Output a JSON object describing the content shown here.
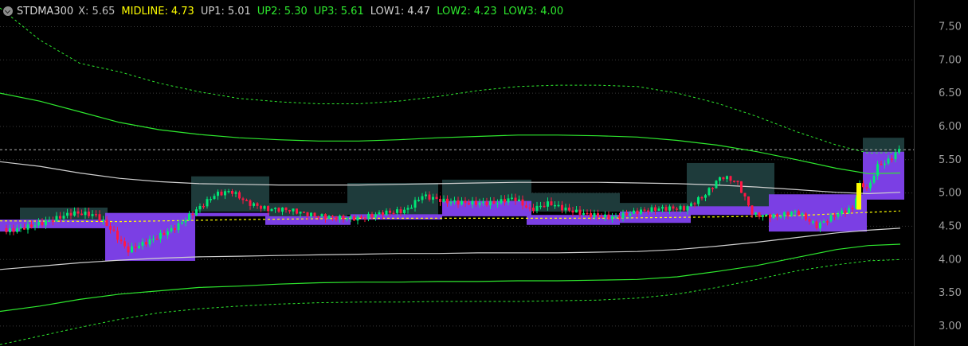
{
  "legend": {
    "name": "STDMA300",
    "items": [
      {
        "label": "X:",
        "value": "5.65",
        "color": "#bdbdbd"
      },
      {
        "label": "MIDLINE:",
        "value": "4.73",
        "color": "#ffff00"
      },
      {
        "label": "UP1:",
        "value": "5.01",
        "color": "#d0d0d0"
      },
      {
        "label": "UP2:",
        "value": "5.30",
        "color": "#2ee82e"
      },
      {
        "label": "UP3:",
        "value": "5.61",
        "color": "#2ee82e"
      },
      {
        "label": "LOW1:",
        "value": "4.47",
        "color": "#d0d0d0"
      },
      {
        "label": "LOW2:",
        "value": "4.23",
        "color": "#2ee82e"
      },
      {
        "label": "LOW3:",
        "value": "4.00",
        "color": "#2ee82e"
      }
    ]
  },
  "colors": {
    "background": "#000000",
    "up_candle": "#00e676",
    "down_candle": "#ff1744",
    "band_green": "#2ee82e",
    "band_white": "#d0d0d0",
    "midline": "#ffff00",
    "purple_box": "#7b3fe4",
    "teal_box": "#1e3b3b",
    "axis_text": "#9e9e9e"
  },
  "chart_data": {
    "type": "line",
    "ylim": [
      2.7,
      7.9
    ],
    "y_ticks": [
      "7.50",
      "7.00",
      "6.50",
      "6.00",
      "5.50",
      "5.00",
      "4.50",
      "4.00",
      "3.50",
      "3.00"
    ],
    "price_reference_line": 5.65,
    "series": [
      {
        "name": "UP3",
        "style": "green-dashed",
        "points": [
          [
            0,
            7.78
          ],
          [
            50,
            7.3
          ],
          [
            100,
            6.95
          ],
          [
            150,
            6.82
          ],
          [
            200,
            6.65
          ],
          [
            250,
            6.52
          ],
          [
            300,
            6.42
          ],
          [
            350,
            6.37
          ],
          [
            400,
            6.34
          ],
          [
            450,
            6.34
          ],
          [
            500,
            6.38
          ],
          [
            550,
            6.45
          ],
          [
            600,
            6.54
          ],
          [
            650,
            6.6
          ],
          [
            700,
            6.62
          ],
          [
            750,
            6.62
          ],
          [
            800,
            6.6
          ],
          [
            850,
            6.5
          ],
          [
            900,
            6.35
          ],
          [
            950,
            6.15
          ],
          [
            1000,
            5.92
          ],
          [
            1050,
            5.72
          ],
          [
            1090,
            5.6
          ],
          [
            1130,
            5.61
          ]
        ]
      },
      {
        "name": "UP2",
        "style": "green-solid",
        "points": [
          [
            0,
            6.5
          ],
          [
            50,
            6.38
          ],
          [
            100,
            6.22
          ],
          [
            150,
            6.06
          ],
          [
            200,
            5.95
          ],
          [
            250,
            5.88
          ],
          [
            300,
            5.83
          ],
          [
            350,
            5.8
          ],
          [
            400,
            5.78
          ],
          [
            450,
            5.78
          ],
          [
            500,
            5.8
          ],
          [
            550,
            5.83
          ],
          [
            600,
            5.85
          ],
          [
            650,
            5.87
          ],
          [
            700,
            5.87
          ],
          [
            750,
            5.86
          ],
          [
            800,
            5.84
          ],
          [
            850,
            5.79
          ],
          [
            900,
            5.72
          ],
          [
            950,
            5.62
          ],
          [
            1000,
            5.5
          ],
          [
            1050,
            5.37
          ],
          [
            1090,
            5.29
          ],
          [
            1130,
            5.3
          ]
        ]
      },
      {
        "name": "UP1",
        "style": "white-solid",
        "points": [
          [
            0,
            5.47
          ],
          [
            50,
            5.4
          ],
          [
            100,
            5.3
          ],
          [
            150,
            5.22
          ],
          [
            200,
            5.17
          ],
          [
            250,
            5.14
          ],
          [
            300,
            5.13
          ],
          [
            350,
            5.12
          ],
          [
            400,
            5.12
          ],
          [
            450,
            5.12
          ],
          [
            500,
            5.13
          ],
          [
            550,
            5.14
          ],
          [
            600,
            5.15
          ],
          [
            650,
            5.16
          ],
          [
            700,
            5.16
          ],
          [
            750,
            5.16
          ],
          [
            800,
            5.15
          ],
          [
            850,
            5.14
          ],
          [
            900,
            5.12
          ],
          [
            950,
            5.09
          ],
          [
            1000,
            5.05
          ],
          [
            1050,
            5.01
          ],
          [
            1090,
            4.99
          ],
          [
            1130,
            5.01
          ]
        ]
      },
      {
        "name": "MIDLINE",
        "style": "yellow-dashed",
        "points": [
          [
            0,
            4.58
          ],
          [
            150,
            4.57
          ],
          [
            300,
            4.6
          ],
          [
            450,
            4.62
          ],
          [
            600,
            4.62
          ],
          [
            750,
            4.62
          ],
          [
            900,
            4.64
          ],
          [
            1000,
            4.66
          ],
          [
            1130,
            4.73
          ]
        ]
      },
      {
        "name": "LOW1",
        "style": "white-solid",
        "points": [
          [
            0,
            3.85
          ],
          [
            50,
            3.9
          ],
          [
            100,
            3.95
          ],
          [
            150,
            3.99
          ],
          [
            200,
            4.02
          ],
          [
            250,
            4.04
          ],
          [
            300,
            4.05
          ],
          [
            350,
            4.06
          ],
          [
            400,
            4.07
          ],
          [
            450,
            4.08
          ],
          [
            500,
            4.09
          ],
          [
            550,
            4.09
          ],
          [
            600,
            4.1
          ],
          [
            650,
            4.1
          ],
          [
            700,
            4.1
          ],
          [
            750,
            4.11
          ],
          [
            800,
            4.12
          ],
          [
            850,
            4.15
          ],
          [
            900,
            4.2
          ],
          [
            950,
            4.26
          ],
          [
            1000,
            4.33
          ],
          [
            1050,
            4.4
          ],
          [
            1090,
            4.44
          ],
          [
            1130,
            4.47
          ]
        ]
      },
      {
        "name": "LOW2",
        "style": "green-solid",
        "points": [
          [
            0,
            3.22
          ],
          [
            50,
            3.3
          ],
          [
            100,
            3.4
          ],
          [
            150,
            3.48
          ],
          [
            200,
            3.53
          ],
          [
            250,
            3.58
          ],
          [
            300,
            3.6
          ],
          [
            350,
            3.63
          ],
          [
            400,
            3.65
          ],
          [
            450,
            3.66
          ],
          [
            500,
            3.66
          ],
          [
            550,
            3.67
          ],
          [
            600,
            3.67
          ],
          [
            650,
            3.68
          ],
          [
            700,
            3.68
          ],
          [
            750,
            3.69
          ],
          [
            800,
            3.7
          ],
          [
            850,
            3.74
          ],
          [
            900,
            3.82
          ],
          [
            950,
            3.91
          ],
          [
            1000,
            4.03
          ],
          [
            1050,
            4.15
          ],
          [
            1090,
            4.21
          ],
          [
            1130,
            4.23
          ]
        ]
      },
      {
        "name": "LOW3",
        "style": "green-dashed",
        "points": [
          [
            0,
            2.72
          ],
          [
            50,
            2.85
          ],
          [
            100,
            2.98
          ],
          [
            150,
            3.1
          ],
          [
            200,
            3.2
          ],
          [
            250,
            3.26
          ],
          [
            300,
            3.3
          ],
          [
            350,
            3.33
          ],
          [
            400,
            3.35
          ],
          [
            450,
            3.36
          ],
          [
            500,
            3.36
          ],
          [
            550,
            3.37
          ],
          [
            600,
            3.37
          ],
          [
            650,
            3.37
          ],
          [
            700,
            3.38
          ],
          [
            750,
            3.39
          ],
          [
            800,
            3.42
          ],
          [
            850,
            3.48
          ],
          [
            900,
            3.58
          ],
          [
            950,
            3.7
          ],
          [
            1000,
            3.83
          ],
          [
            1050,
            3.92
          ],
          [
            1090,
            3.98
          ],
          [
            1130,
            4.0
          ]
        ]
      }
    ],
    "boxes": [
      {
        "color": "purple",
        "x1": 0,
        "x2": 25,
        "y1": 4.42,
        "y2": 4.6
      },
      {
        "color": "teal",
        "x1": 25,
        "x2": 135,
        "y1": 4.6,
        "y2": 4.78
      },
      {
        "color": "purple",
        "x1": 25,
        "x2": 135,
        "y1": 4.47,
        "y2": 4.6
      },
      {
        "color": "purple",
        "x1": 132,
        "x2": 245,
        "y1": 3.98,
        "y2": 4.7
      },
      {
        "color": "teal",
        "x1": 240,
        "x2": 338,
        "y1": 4.72,
        "y2": 5.25
      },
      {
        "color": "purple",
        "x1": 240,
        "x2": 338,
        "y1": 4.65,
        "y2": 4.7
      },
      {
        "color": "teal",
        "x1": 338,
        "x2": 436,
        "y1": 4.6,
        "y2": 4.85
      },
      {
        "color": "purple",
        "x1": 333,
        "x2": 440,
        "y1": 4.52,
        "y2": 4.65
      },
      {
        "color": "teal",
        "x1": 436,
        "x2": 550,
        "y1": 4.67,
        "y2": 5.15
      },
      {
        "color": "purple",
        "x1": 440,
        "x2": 555,
        "y1": 4.6,
        "y2": 4.68
      },
      {
        "color": "teal",
        "x1": 555,
        "x2": 667,
        "y1": 4.77,
        "y2": 5.2
      },
      {
        "color": "purple",
        "x1": 555,
        "x2": 667,
        "y1": 4.65,
        "y2": 4.88
      },
      {
        "color": "teal",
        "x1": 667,
        "x2": 778,
        "y1": 4.72,
        "y2": 5.0
      },
      {
        "color": "purple",
        "x1": 661,
        "x2": 778,
        "y1": 4.52,
        "y2": 4.67
      },
      {
        "color": "teal",
        "x1": 778,
        "x2": 862,
        "y1": 4.72,
        "y2": 4.85
      },
      {
        "color": "purple",
        "x1": 778,
        "x2": 867,
        "y1": 4.55,
        "y2": 4.72
      },
      {
        "color": "teal",
        "x1": 862,
        "x2": 972,
        "y1": 4.78,
        "y2": 5.45
      },
      {
        "color": "purple",
        "x1": 862,
        "x2": 972,
        "y1": 4.67,
        "y2": 4.8
      },
      {
        "color": "purple",
        "x1": 965,
        "x2": 1088,
        "y1": 4.42,
        "y2": 4.98
      },
      {
        "color": "teal",
        "x1": 1083,
        "x2": 1135,
        "y1": 5.62,
        "y2": 5.83
      },
      {
        "color": "purple",
        "x1": 1083,
        "x2": 1135,
        "y1": 4.9,
        "y2": 5.62
      }
    ],
    "price_path": [
      [
        5,
        4.47
      ],
      [
        30,
        4.52
      ],
      [
        60,
        4.58
      ],
      [
        90,
        4.67
      ],
      [
        120,
        4.62
      ],
      [
        140,
        4.4
      ],
      [
        160,
        4.1
      ],
      [
        190,
        4.3
      ],
      [
        220,
        4.52
      ],
      [
        245,
        4.78
      ],
      [
        270,
        5.02
      ],
      [
        290,
        5.05
      ],
      [
        310,
        4.85
      ],
      [
        335,
        4.72
      ],
      [
        360,
        4.7
      ],
      [
        390,
        4.63
      ],
      [
        420,
        4.62
      ],
      [
        450,
        4.65
      ],
      [
        480,
        4.75
      ],
      [
        510,
        4.78
      ],
      [
        530,
        4.98
      ],
      [
        560,
        4.85
      ],
      [
        590,
        4.8
      ],
      [
        620,
        4.8
      ],
      [
        645,
        4.9
      ],
      [
        665,
        4.75
      ],
      [
        690,
        4.88
      ],
      [
        710,
        4.8
      ],
      [
        740,
        4.72
      ],
      [
        770,
        4.65
      ],
      [
        800,
        4.7
      ],
      [
        830,
        4.72
      ],
      [
        860,
        4.72
      ],
      [
        885,
        4.95
      ],
      [
        905,
        5.25
      ],
      [
        925,
        5.2
      ],
      [
        945,
        4.72
      ],
      [
        975,
        4.7
      ],
      [
        1000,
        4.75
      ],
      [
        1025,
        4.5
      ],
      [
        1050,
        4.65
      ],
      [
        1070,
        4.72
      ],
      [
        1080,
        5.1
      ],
      [
        1090,
        5.0
      ],
      [
        1100,
        5.35
      ],
      [
        1115,
        5.45
      ],
      [
        1130,
        5.65
      ]
    ],
    "highlight_bar": {
      "x": 1078,
      "open": 4.75,
      "close": 5.15,
      "color": "#ffff00"
    }
  }
}
